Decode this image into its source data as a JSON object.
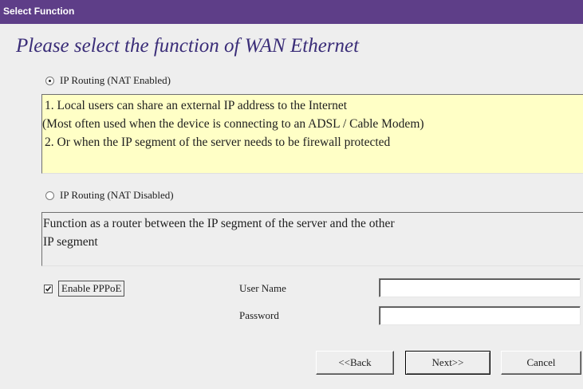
{
  "window": {
    "title": "Select Function"
  },
  "heading": "Please select the function of WAN Ethernet",
  "options": [
    {
      "label": "IP Routing (NAT Enabled)",
      "selected": true,
      "description": [
        "1. Local users can share an external IP address to the Internet",
        "(Most often used when the device is connecting to an ADSL / Cable Modem)",
        "2. Or when the IP segment of the server needs to be firewall protected"
      ]
    },
    {
      "label": "IP Routing (NAT Disabled)",
      "selected": false,
      "description": [
        "Function as a router between the IP segment of the server and the other",
        "IP segment"
      ]
    }
  ],
  "pppoe": {
    "label": "Enable PPPoE",
    "checked": true,
    "user_name_label": "User Name",
    "user_name_value": "",
    "password_label": "Password",
    "password_value": ""
  },
  "buttons": {
    "back": "<<Back",
    "next": "Next>>",
    "cancel": "Cancel"
  },
  "colors": {
    "titlebar": "#5e3e88",
    "heading": "#3a2d78",
    "highlight_panel": "#ffffc6",
    "background": "#eeeeee"
  }
}
